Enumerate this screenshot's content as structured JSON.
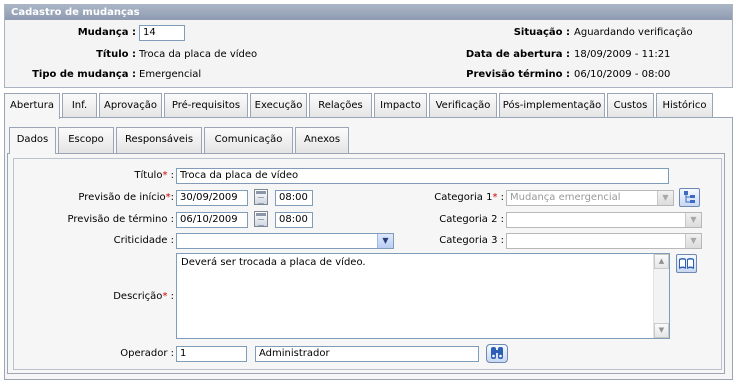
{
  "header": {
    "title": "Cadastro de mudanças",
    "mudanca_label": "Mudança :",
    "mudanca_value": "14",
    "titulo_label": "Título :",
    "titulo_value": "Troca da placa de vídeo",
    "tipo_label": "Tipo de mudança :",
    "tipo_value": "Emergencial",
    "situacao_label": "Situação :",
    "situacao_value": "Aguardando verificação",
    "abertura_label": "Data de abertura :",
    "abertura_value": "18/09/2009 - 11:21",
    "previsao_label": "Previsão término :",
    "previsao_value": "06/10/2009 - 08:00"
  },
  "main_tabs": [
    "Abertura",
    "Inf.",
    "Aprovação",
    "Pré-requisitos",
    "Execução",
    "Relações",
    "Impacto",
    "Verificação",
    "Pós-implementação",
    "Custos",
    "Histórico"
  ],
  "main_tabs_active": "Abertura",
  "sub_tabs": [
    "Dados",
    "Escopo",
    "Responsáveis",
    "Comunicação",
    "Anexos"
  ],
  "sub_tabs_active": "Dados",
  "form": {
    "titulo_label": "Título",
    "titulo_value": "Troca da placa de vídeo",
    "inicio_label": "Previsão de início",
    "inicio_date": "30/09/2009",
    "inicio_time": "08:00",
    "termino_label": "Previsão de término :",
    "termino_date": "06/10/2009",
    "termino_time": "08:00",
    "criticidade_label": "Criticidade :",
    "criticidade_value": "",
    "categoria1_label": "Categoria 1",
    "categoria1_value": "Mudança emergencial",
    "categoria2_label": "Categoria 2 :",
    "categoria2_value": "",
    "categoria3_label": "Categoria 3 :",
    "categoria3_value": "",
    "descricao_label": "Descrição",
    "descricao_value": "Deverá ser trocada a placa de vídeo.",
    "operador_label": "Operador :",
    "operador_id": "1",
    "operador_name": "Administrador",
    "required_mark": "*",
    "colon": ":"
  },
  "colors": {
    "header_bar": "#8e9ab0",
    "required": "#d00000",
    "input_border": "#7f9db9"
  },
  "icons": {
    "calendar": "calendar-icon",
    "category_tree": "category-tree-icon",
    "book": "book-icon",
    "operator_search": "operator-search-icon"
  }
}
